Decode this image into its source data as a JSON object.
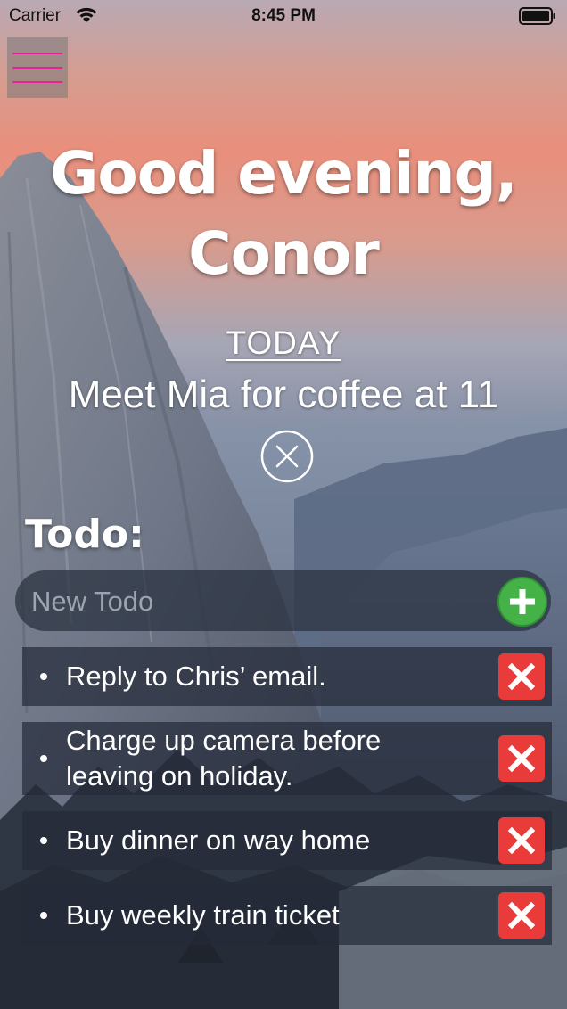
{
  "status_bar": {
    "carrier": "Carrier",
    "time": "8:45 PM"
  },
  "greeting": {
    "line1": "Good evening,",
    "line2": "Conor"
  },
  "today": {
    "label": "TODAY",
    "task": "Meet Mia for coffee at 11"
  },
  "todo": {
    "heading": "Todo:",
    "input_placeholder": "New Todo",
    "items": [
      {
        "text": "Reply to Chris’ email."
      },
      {
        "text": "Charge up camera before leaving on holiday."
      },
      {
        "text": "Buy dinner on way home"
      },
      {
        "text": "Buy weekly train ticket"
      }
    ]
  },
  "colors": {
    "menu_accent": "#e8219a",
    "add_button": "#45b248",
    "delete_button": "#ea3b3b"
  },
  "icons": {
    "menu": "hamburger-icon",
    "clear_today": "close-circle-icon",
    "add": "plus-icon",
    "delete": "x-icon"
  }
}
